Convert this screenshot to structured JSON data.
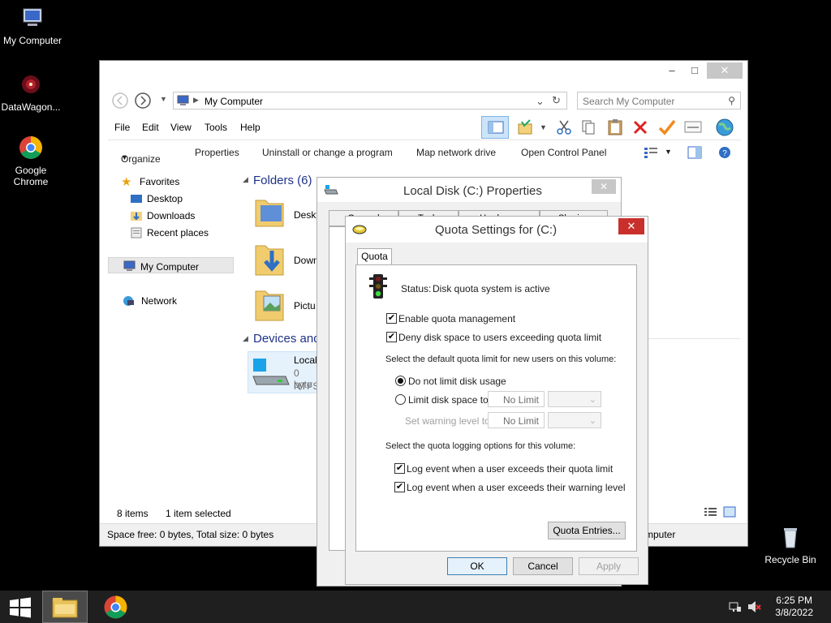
{
  "desktop": {
    "icons": [
      {
        "label": "My Computer"
      },
      {
        "label": "DataWagon..."
      },
      {
        "label": "Google Chrome"
      },
      {
        "label": "Recycle Bin"
      }
    ]
  },
  "explorer": {
    "address": "My Computer",
    "search_placeholder": "Search My Computer",
    "menu": [
      "File",
      "Edit",
      "View",
      "Tools",
      "Help"
    ],
    "commands": [
      "Organize",
      "Properties",
      "Uninstall or change a program",
      "Map network drive",
      "Open Control Panel"
    ],
    "nav": {
      "favorites": "Favorites",
      "desktop": "Desktop",
      "downloads": "Downloads",
      "recent": "Recent places",
      "my_computer": "My Computer",
      "network": "Network"
    },
    "folders_header": "Folders (6)",
    "devices_header": "Devices and",
    "folders": [
      "Deskt",
      "Down",
      "Pictu"
    ],
    "drive": {
      "name": "Local",
      "size": "0 byte",
      "fs": "NTFS"
    },
    "status_items": "8 items",
    "status_selected": "1 item selected",
    "status_space": "Space free: 0 bytes, Total size: 0 bytes",
    "status_right": "mputer"
  },
  "props_dialog": {
    "title": "Local Disk (C:) Properties",
    "tabs": [
      "General",
      "Tools",
      "Hardware",
      "Sharing"
    ]
  },
  "quota_dialog": {
    "title": "Quota Settings for  (C:)",
    "tab": "Quota",
    "status_label": "Status:",
    "status_value": "Disk quota system is active",
    "enable_quota": "Enable quota management",
    "deny_space": "Deny disk space to users exceeding quota limit",
    "default_limit_heading": "Select the default quota limit for new users on this volume:",
    "no_limit_option": "Do not limit disk usage",
    "limit_option": "Limit disk space to",
    "limit_value": "No Limit",
    "warning_label": "Set warning level to",
    "warning_value": "No Limit",
    "logging_heading": "Select the quota logging options for this volume:",
    "log_quota": "Log event when a user exceeds their quota limit",
    "log_warning": "Log event when a user exceeds their warning level",
    "entries_button": "Quota Entries...",
    "ok": "OK",
    "cancel": "Cancel",
    "apply": "Apply"
  },
  "taskbar": {
    "time": "6:25 PM",
    "date": "3/8/2022"
  },
  "colors": {
    "accent_close": "#c9302c",
    "taskbar_bg": "#1f1f1f",
    "header_blue": "#1e3287"
  }
}
